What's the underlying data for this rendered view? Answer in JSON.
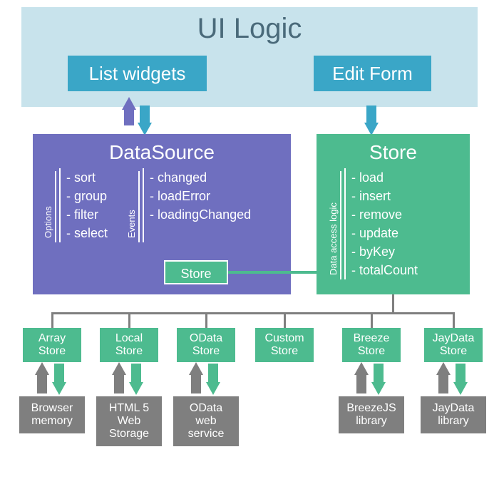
{
  "ui": {
    "title": "UI Logic",
    "listWidgets": "List widgets",
    "editForm": "Edit Form"
  },
  "datasource": {
    "title": "DataSource",
    "optionsLabel": "Options",
    "options": [
      "sort",
      "group",
      "filter",
      "select"
    ],
    "eventsLabel": "Events",
    "events": [
      "changed",
      "loadError",
      "loadingChanged"
    ],
    "storePill": "Store"
  },
  "store": {
    "title": "Store",
    "methodsLabel": "Data access logic",
    "methods": [
      "load",
      "insert",
      "remove",
      "update",
      "byKey",
      "totalCount"
    ]
  },
  "stores": {
    "array": "Array\nStore",
    "local": "Local\nStore",
    "odata": "OData\nStore",
    "custom": "Custom\nStore",
    "breeze": "Breeze\nStore",
    "jaydata": "JayData\nStore"
  },
  "sources": {
    "browser": "Browser\nmemory",
    "html5": "HTML 5\nWeb\nStorage",
    "odata": "OData\nweb\nservice",
    "breeze": "BreezeJS\nlibrary",
    "jaydata": "JayData\nlibrary"
  },
  "colors": {
    "cyan": "#3aa6c7",
    "purple": "#6f6fbf",
    "green": "#4dbb8f",
    "gray": "#7f7f7f"
  }
}
